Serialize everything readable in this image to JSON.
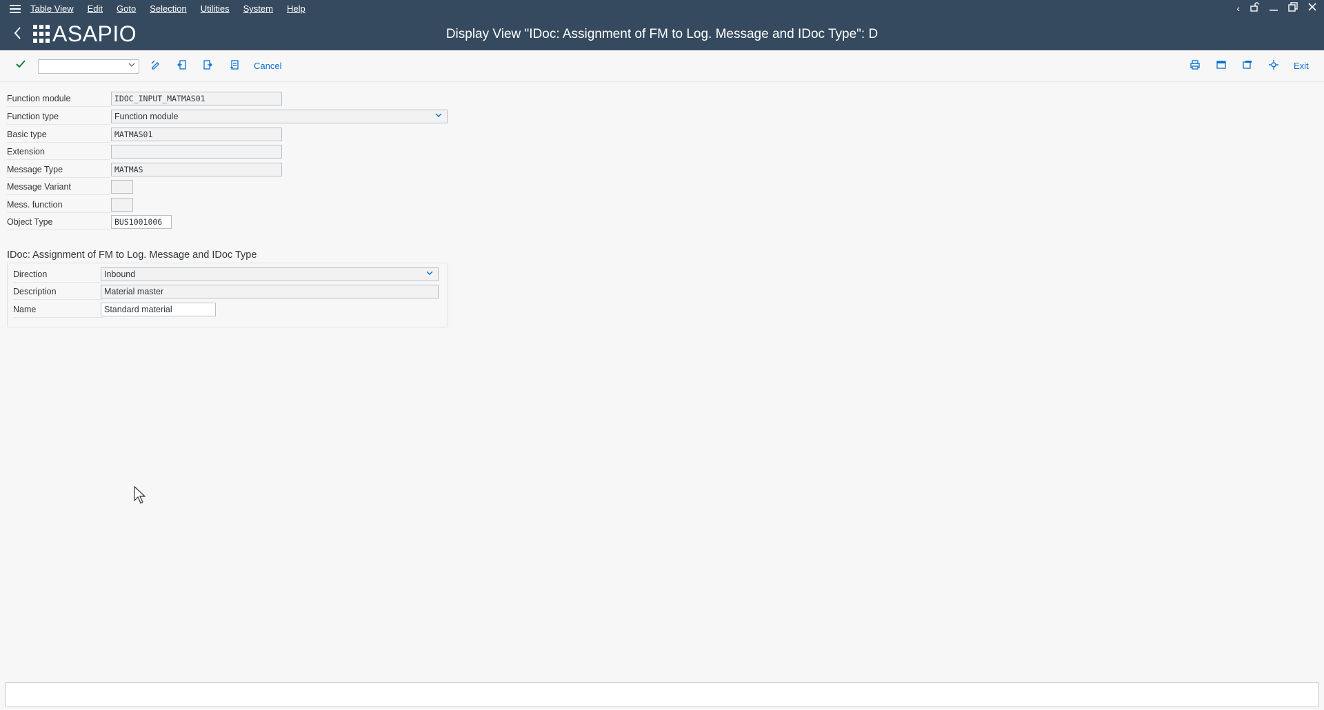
{
  "menubar": {
    "items": [
      "Table View",
      "Edit",
      "Goto",
      "Selection",
      "Utilities",
      "System",
      "Help"
    ]
  },
  "window_controls": [
    "chevron-left",
    "unlock",
    "minimize",
    "restore",
    "close"
  ],
  "header": {
    "logo_text": "ASAPIO",
    "title": "Display View \"IDoc: Assignment of FM to Log. Message and IDoc Type\": D"
  },
  "toolbar": {
    "command_value": "",
    "cancel_label": "Cancel",
    "exit_label": "Exit"
  },
  "form": {
    "function_module_label": "Function module",
    "function_module_value": "IDOC_INPUT_MATMAS01",
    "function_type_label": "Function type",
    "function_type_value": "Function module",
    "basic_type_label": "Basic type",
    "basic_type_value": "MATMAS01",
    "extension_label": "Extension",
    "extension_value": "",
    "message_type_label": "Message Type",
    "message_type_value": "MATMAS",
    "message_variant_label": "Message Variant",
    "message_variant_value": "",
    "mess_function_label": "Mess. function",
    "mess_function_value": "",
    "object_type_label": "Object Type",
    "object_type_value": "BUS1001006"
  },
  "group": {
    "title": "IDoc: Assignment of FM to Log. Message and IDoc Type",
    "direction_label": "Direction",
    "direction_value": "Inbound",
    "description_label": "Description",
    "description_value": "Material master",
    "name_label": "Name",
    "name_value": "Standard material"
  },
  "statusbar": {
    "text": ""
  },
  "colors": {
    "shell_header": "#354a5f",
    "accent": "#0a6ed1",
    "check_green": "#107e3e",
    "background": "#f7f7f7"
  }
}
